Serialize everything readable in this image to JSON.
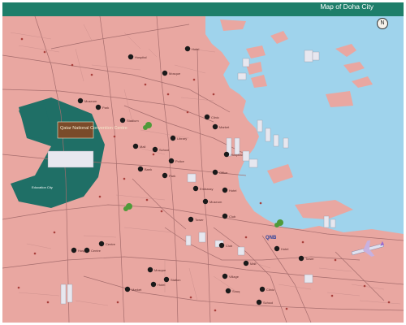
{
  "map": {
    "title": "Map of Doha City",
    "north_label": "N",
    "colors": {
      "land": "#e9a7a1",
      "sea": "#9fd3ec",
      "bar": "#1e7e6a",
      "park": "#1f6f66",
      "road": "#a66d6d",
      "marker": "#1a1a1a"
    },
    "labels": {
      "convention_centre": "Qatar National Convention Centre",
      "qnb": "QNB",
      "education_city": "Education City"
    },
    "pois": [
      {
        "id": "poi-1",
        "label": "Hospital"
      },
      {
        "id": "poi-2",
        "label": "Mosque"
      },
      {
        "id": "poi-3",
        "label": "Hotel"
      },
      {
        "id": "poi-4",
        "label": "Museum"
      },
      {
        "id": "poi-5",
        "label": "Park"
      },
      {
        "id": "poi-6",
        "label": "Stadium"
      },
      {
        "id": "poi-7",
        "label": "Mall"
      },
      {
        "id": "poi-8",
        "label": "School"
      },
      {
        "id": "poi-9",
        "label": "Library"
      },
      {
        "id": "poi-10",
        "label": "Clinic"
      },
      {
        "id": "poi-11",
        "label": "Market"
      },
      {
        "id": "poi-12",
        "label": "Police"
      },
      {
        "id": "poi-13",
        "label": "Bank"
      },
      {
        "id": "poi-14",
        "label": "Office"
      },
      {
        "id": "poi-15",
        "label": "Embassy"
      },
      {
        "id": "poi-16",
        "label": "Hotel"
      },
      {
        "id": "poi-17",
        "label": "Museum"
      },
      {
        "id": "poi-18",
        "label": "Tower"
      },
      {
        "id": "poi-19",
        "label": "Club"
      },
      {
        "id": "poi-20",
        "label": "Centre"
      },
      {
        "id": "poi-21",
        "label": "Hospital"
      },
      {
        "id": "poi-22",
        "label": "Mosque"
      },
      {
        "id": "poi-23",
        "label": "Station"
      },
      {
        "id": "poi-24",
        "label": "Hotel"
      },
      {
        "id": "poi-25",
        "label": "Village"
      },
      {
        "id": "poi-26",
        "label": "Souq"
      },
      {
        "id": "poi-27",
        "label": "Mall"
      },
      {
        "id": "poi-28",
        "label": "Clinic"
      },
      {
        "id": "poi-29",
        "label": "School"
      },
      {
        "id": "poi-30",
        "label": "Tower"
      },
      {
        "id": "poi-31",
        "label": "Hotel"
      },
      {
        "id": "poi-32",
        "label": "Market"
      },
      {
        "id": "poi-33",
        "label": "Centre"
      },
      {
        "id": "poi-34",
        "label": "Park"
      },
      {
        "id": "poi-35",
        "label": "Club"
      },
      {
        "id": "poi-36",
        "label": "Hospital"
      }
    ]
  }
}
